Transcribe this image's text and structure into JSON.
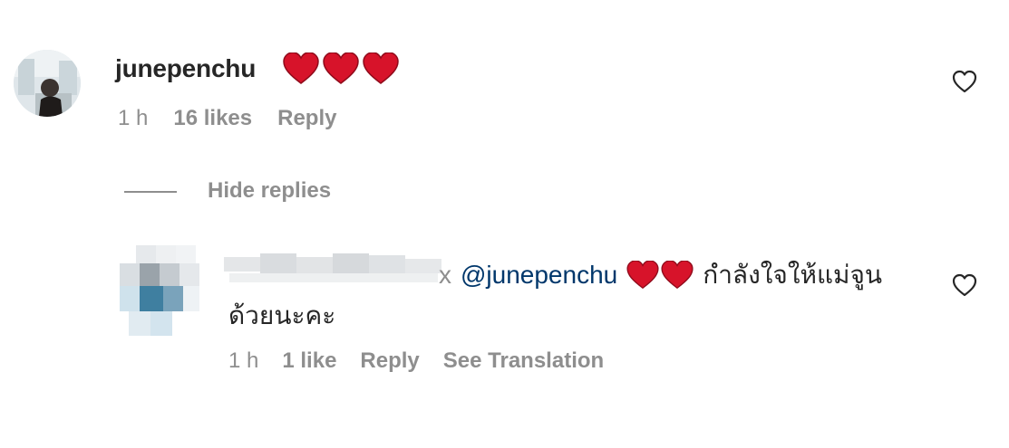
{
  "comment": {
    "username": "junepenchu",
    "emoji": [
      "heart",
      "heart",
      "heart"
    ],
    "time": "1 h",
    "likes": "16 likes",
    "reply_label": "Reply",
    "like_icon": "heart-outline-icon"
  },
  "thread": {
    "hide_replies_label": "Hide replies"
  },
  "reply": {
    "username_hint": "x",
    "mention": "@junepenchu",
    "emoji": [
      "heart",
      "heart"
    ],
    "text_line1": "กำลังใจให้แม่จูน",
    "text_line2": "ด้วยนะคะ",
    "time": "1 h",
    "likes": "1 like",
    "reply_label": "Reply",
    "translation_label": "See Translation",
    "like_icon": "heart-outline-icon"
  },
  "colors": {
    "text": "#262626",
    "secondary": "#8e8e8e",
    "mention": "#00376b",
    "heart": "#d7132a"
  }
}
